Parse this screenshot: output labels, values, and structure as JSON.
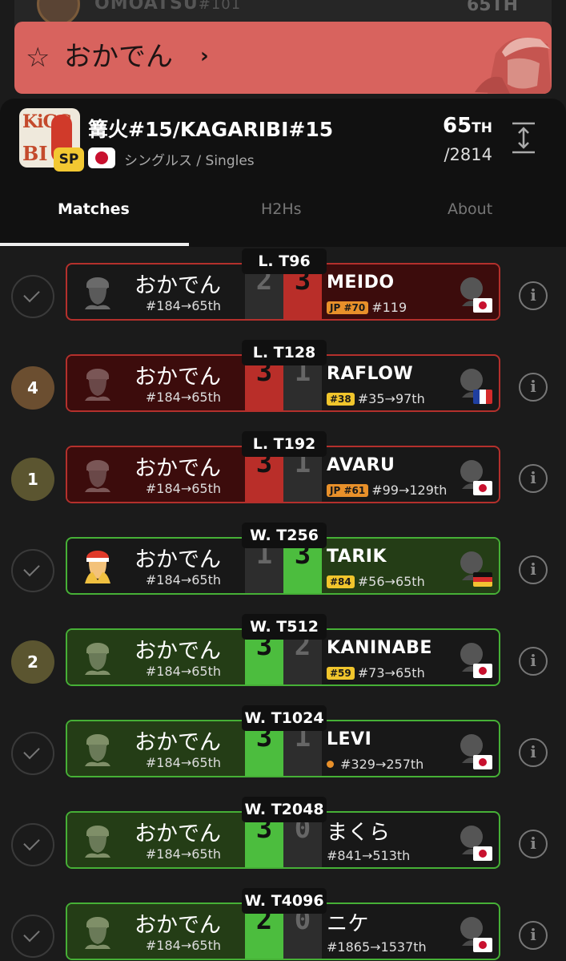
{
  "peek": {
    "name": "OMOATSU",
    "suffix": "#101",
    "rank": "65TH"
  },
  "banner": {
    "player": "おかでん",
    "chevron": "›",
    "star": "☆"
  },
  "tournament": {
    "name": "篝火#15/KAGARIBI#15",
    "badge": "SP",
    "event": "シングルス / Singles",
    "placement": "65",
    "placement_suffix": "TH",
    "entrants": "/2814",
    "logo_top": "KiGG",
    "logo_bottom": "BI"
  },
  "tabs": [
    {
      "label": "Matches"
    },
    {
      "label": "H2Hs"
    },
    {
      "label": "About"
    }
  ],
  "matches": [
    {
      "status": "check",
      "round": "L. T96",
      "player": "おかでん",
      "seed": "#184→65th",
      "score_p": "2",
      "score_o": "3",
      "result": "loss",
      "opponent": "MEIDO",
      "badge": "JP #70",
      "badge_color": "orange",
      "opp_seed": "#119",
      "flag": "jp"
    },
    {
      "status": "4",
      "round": "L. T128",
      "player": "おかでん",
      "seed": "#184→65th",
      "score_p": "3",
      "score_o": "1",
      "result": "win-red",
      "opponent": "RAFLOW",
      "badge": "#38",
      "badge_color": "yellow",
      "opp_seed": "#35→97th",
      "flag": "fr"
    },
    {
      "status": "1",
      "round": "L. T192",
      "player": "おかでん",
      "seed": "#184→65th",
      "score_p": "3",
      "score_o": "1",
      "result": "win-red",
      "opponent": "AVARU",
      "badge": "JP #61",
      "badge_color": "orange",
      "opp_seed": "#99→129th",
      "flag": "jp"
    },
    {
      "status": "check",
      "round": "W. T256",
      "player": "おかでん",
      "seed": "#184→65th",
      "score_p": "1",
      "score_o": "3",
      "result": "loss-green",
      "opponent": "TARIK",
      "badge": "#84",
      "badge_color": "yellow",
      "opp_seed": "#56→65th",
      "flag": "de"
    },
    {
      "status": "2",
      "round": "W. T512",
      "player": "おかでん",
      "seed": "#184→65th",
      "score_p": "3",
      "score_o": "2",
      "result": "win",
      "opponent": "KANINABE",
      "badge": "#59",
      "badge_color": "yellow",
      "opp_seed": "#73→65th",
      "flag": "jp"
    },
    {
      "status": "check",
      "round": "W. T1024",
      "player": "おかでん",
      "seed": "#184→65th",
      "score_p": "3",
      "score_o": "1",
      "result": "win",
      "opponent": "LEVI",
      "badge": "",
      "badge_color": "dot",
      "opp_seed": "#329→257th",
      "flag": "jp"
    },
    {
      "status": "check",
      "round": "W. T2048",
      "player": "おかでん",
      "seed": "#184→65th",
      "score_p": "3",
      "score_o": "0",
      "result": "win",
      "opponent": "まくら",
      "badge": "",
      "badge_color": "none",
      "opp_seed": "#841→513th",
      "flag": "jp"
    },
    {
      "status": "check",
      "round": "W. T4096",
      "player": "おかでん",
      "seed": "#184→65th",
      "score_p": "2",
      "score_o": "0",
      "result": "win",
      "opponent": "ニケ",
      "badge": "",
      "badge_color": "none",
      "opp_seed": "#1865→1537th",
      "flag": "jp"
    }
  ],
  "info_icon": "i"
}
